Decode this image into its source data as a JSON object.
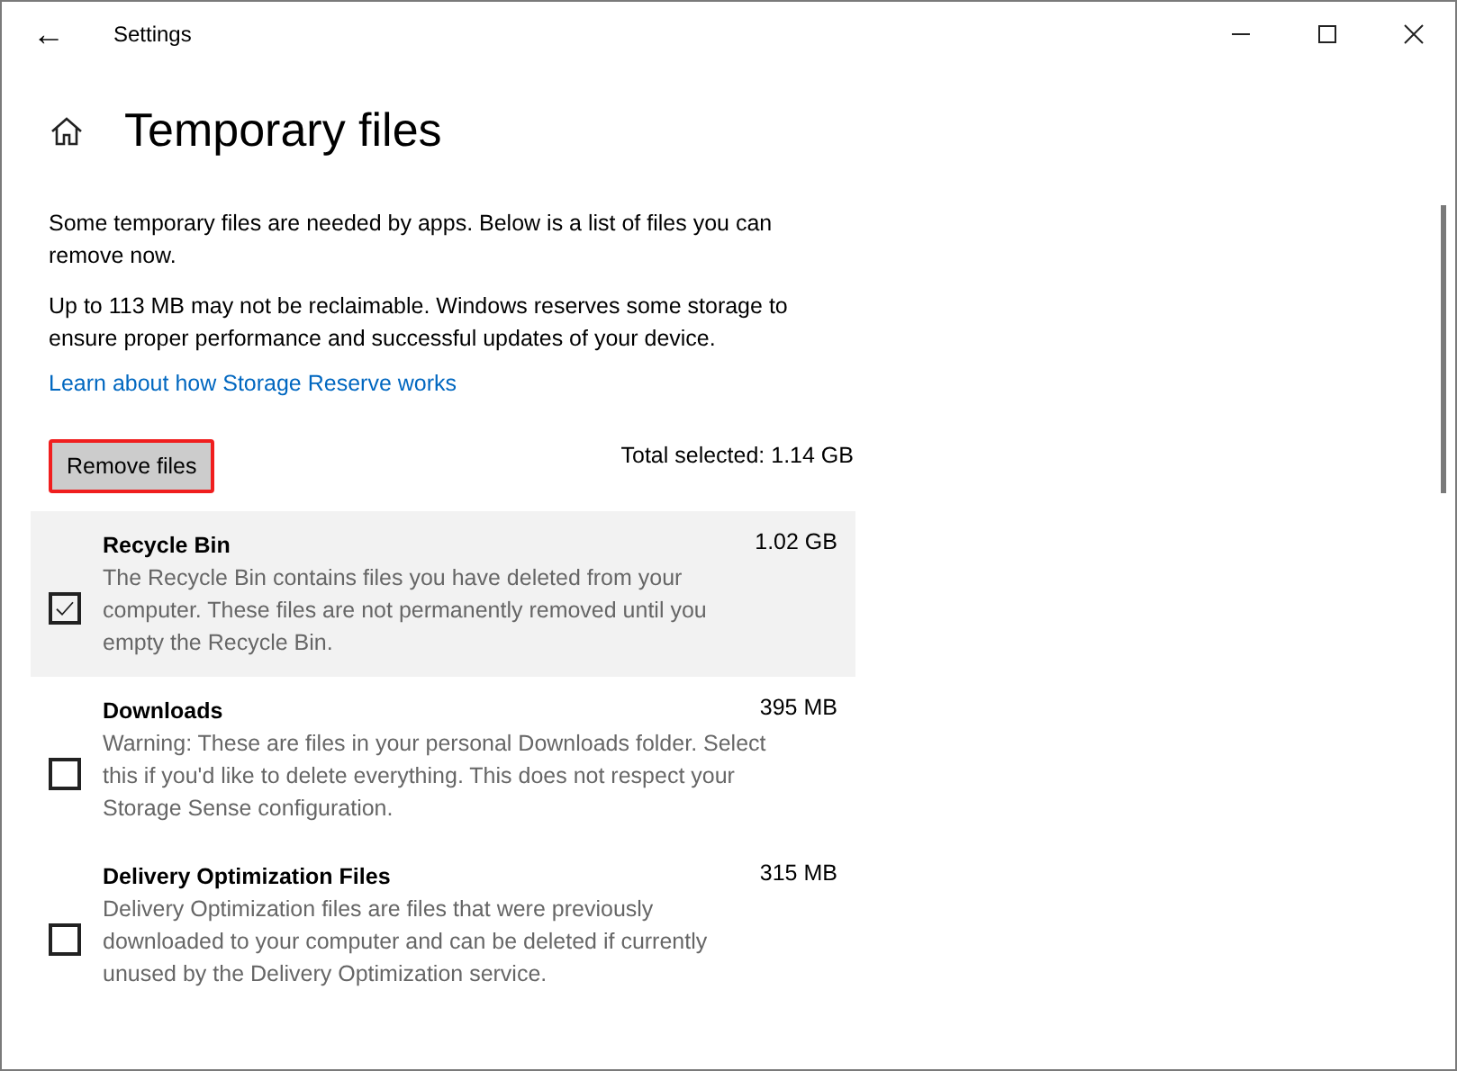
{
  "window": {
    "title": "Settings",
    "back": "←"
  },
  "page": {
    "title": "Temporary files"
  },
  "intro": [
    "Some temporary files are needed by apps. Below is a list of files you can remove now.",
    "Up to 113 MB may not be reclaimable. Windows reserves some storage to ensure proper performance and successful updates of your device."
  ],
  "link": "Learn about how Storage Reserve works",
  "remove_button": {
    "label": "Remove files",
    "highlighted": true
  },
  "total_selected": "Total selected: 1.14 GB",
  "items": [
    {
      "name": "Recycle Bin",
      "size": "1.02 GB",
      "description": "The Recycle Bin contains files you have deleted from your computer. These files are not permanently removed until you empty the Recycle Bin.",
      "checked": true,
      "hovered": true
    },
    {
      "name": "Downloads",
      "size": "395 MB",
      "description": "Warning: These are files in your personal Downloads folder. Select this if you'd like to delete everything. This does not respect your Storage Sense configuration.",
      "checked": false,
      "hovered": false
    },
    {
      "name": "Delivery Optimization Files",
      "size": "315 MB",
      "description": "Delivery Optimization files are files that were previously downloaded to your computer and can be deleted if currently unused by the Delivery Optimization service.",
      "checked": false,
      "hovered": false
    }
  ]
}
